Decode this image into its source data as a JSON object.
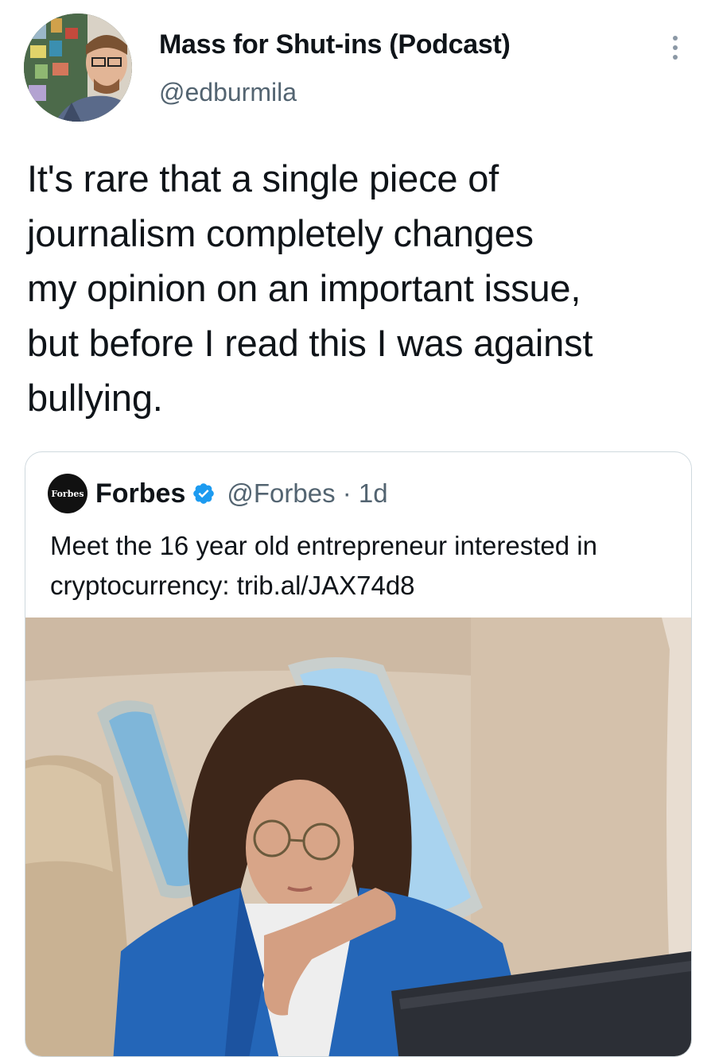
{
  "tweet": {
    "display_name": "Mass for Shut-ins (Podcast)",
    "handle": "@edburmila",
    "text_lines": [
      "It's rare that a single piece of",
      "journalism completely changes",
      "my opinion on an important issue,",
      "but before I read this I was against",
      "bullying."
    ]
  },
  "quoted_tweet": {
    "logo_text": "Forbes",
    "display_name": "Forbes",
    "handle_and_time": "@Forbes · 1d",
    "text_lines": [
      "Meet the 16 year old entrepreneur interested in",
      "cryptocurrency: trib.al/JAX74d8"
    ]
  },
  "icons": {
    "more": "more-vertical-icon",
    "verified": "verified-badge-icon"
  },
  "colors": {
    "verified_blue": "#1d9bf0",
    "secondary_text": "#536471",
    "card_border": "#cfd9de"
  }
}
